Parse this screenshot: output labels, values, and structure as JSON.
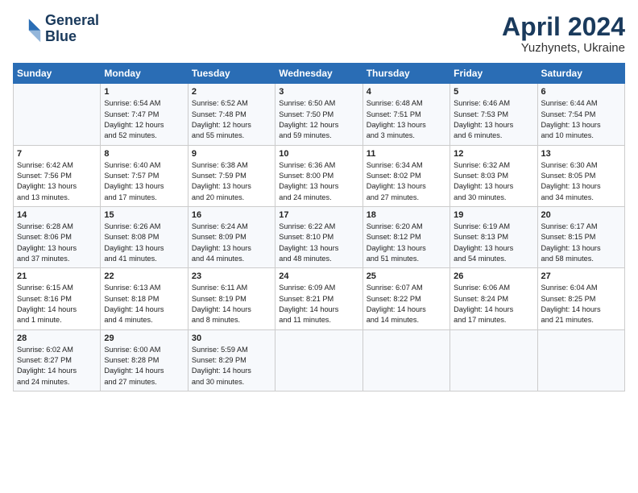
{
  "header": {
    "logo_line1": "General",
    "logo_line2": "Blue",
    "month": "April 2024",
    "location": "Yuzhynets, Ukraine"
  },
  "days_of_week": [
    "Sunday",
    "Monday",
    "Tuesday",
    "Wednesday",
    "Thursday",
    "Friday",
    "Saturday"
  ],
  "weeks": [
    [
      {
        "day": "",
        "info": ""
      },
      {
        "day": "1",
        "info": "Sunrise: 6:54 AM\nSunset: 7:47 PM\nDaylight: 12 hours\nand 52 minutes."
      },
      {
        "day": "2",
        "info": "Sunrise: 6:52 AM\nSunset: 7:48 PM\nDaylight: 12 hours\nand 55 minutes."
      },
      {
        "day": "3",
        "info": "Sunrise: 6:50 AM\nSunset: 7:50 PM\nDaylight: 12 hours\nand 59 minutes."
      },
      {
        "day": "4",
        "info": "Sunrise: 6:48 AM\nSunset: 7:51 PM\nDaylight: 13 hours\nand 3 minutes."
      },
      {
        "day": "5",
        "info": "Sunrise: 6:46 AM\nSunset: 7:53 PM\nDaylight: 13 hours\nand 6 minutes."
      },
      {
        "day": "6",
        "info": "Sunrise: 6:44 AM\nSunset: 7:54 PM\nDaylight: 13 hours\nand 10 minutes."
      }
    ],
    [
      {
        "day": "7",
        "info": "Sunrise: 6:42 AM\nSunset: 7:56 PM\nDaylight: 13 hours\nand 13 minutes."
      },
      {
        "day": "8",
        "info": "Sunrise: 6:40 AM\nSunset: 7:57 PM\nDaylight: 13 hours\nand 17 minutes."
      },
      {
        "day": "9",
        "info": "Sunrise: 6:38 AM\nSunset: 7:59 PM\nDaylight: 13 hours\nand 20 minutes."
      },
      {
        "day": "10",
        "info": "Sunrise: 6:36 AM\nSunset: 8:00 PM\nDaylight: 13 hours\nand 24 minutes."
      },
      {
        "day": "11",
        "info": "Sunrise: 6:34 AM\nSunset: 8:02 PM\nDaylight: 13 hours\nand 27 minutes."
      },
      {
        "day": "12",
        "info": "Sunrise: 6:32 AM\nSunset: 8:03 PM\nDaylight: 13 hours\nand 30 minutes."
      },
      {
        "day": "13",
        "info": "Sunrise: 6:30 AM\nSunset: 8:05 PM\nDaylight: 13 hours\nand 34 minutes."
      }
    ],
    [
      {
        "day": "14",
        "info": "Sunrise: 6:28 AM\nSunset: 8:06 PM\nDaylight: 13 hours\nand 37 minutes."
      },
      {
        "day": "15",
        "info": "Sunrise: 6:26 AM\nSunset: 8:08 PM\nDaylight: 13 hours\nand 41 minutes."
      },
      {
        "day": "16",
        "info": "Sunrise: 6:24 AM\nSunset: 8:09 PM\nDaylight: 13 hours\nand 44 minutes."
      },
      {
        "day": "17",
        "info": "Sunrise: 6:22 AM\nSunset: 8:10 PM\nDaylight: 13 hours\nand 48 minutes."
      },
      {
        "day": "18",
        "info": "Sunrise: 6:20 AM\nSunset: 8:12 PM\nDaylight: 13 hours\nand 51 minutes."
      },
      {
        "day": "19",
        "info": "Sunrise: 6:19 AM\nSunset: 8:13 PM\nDaylight: 13 hours\nand 54 minutes."
      },
      {
        "day": "20",
        "info": "Sunrise: 6:17 AM\nSunset: 8:15 PM\nDaylight: 13 hours\nand 58 minutes."
      }
    ],
    [
      {
        "day": "21",
        "info": "Sunrise: 6:15 AM\nSunset: 8:16 PM\nDaylight: 14 hours\nand 1 minute."
      },
      {
        "day": "22",
        "info": "Sunrise: 6:13 AM\nSunset: 8:18 PM\nDaylight: 14 hours\nand 4 minutes."
      },
      {
        "day": "23",
        "info": "Sunrise: 6:11 AM\nSunset: 8:19 PM\nDaylight: 14 hours\nand 8 minutes."
      },
      {
        "day": "24",
        "info": "Sunrise: 6:09 AM\nSunset: 8:21 PM\nDaylight: 14 hours\nand 11 minutes."
      },
      {
        "day": "25",
        "info": "Sunrise: 6:07 AM\nSunset: 8:22 PM\nDaylight: 14 hours\nand 14 minutes."
      },
      {
        "day": "26",
        "info": "Sunrise: 6:06 AM\nSunset: 8:24 PM\nDaylight: 14 hours\nand 17 minutes."
      },
      {
        "day": "27",
        "info": "Sunrise: 6:04 AM\nSunset: 8:25 PM\nDaylight: 14 hours\nand 21 minutes."
      }
    ],
    [
      {
        "day": "28",
        "info": "Sunrise: 6:02 AM\nSunset: 8:27 PM\nDaylight: 14 hours\nand 24 minutes."
      },
      {
        "day": "29",
        "info": "Sunrise: 6:00 AM\nSunset: 8:28 PM\nDaylight: 14 hours\nand 27 minutes."
      },
      {
        "day": "30",
        "info": "Sunrise: 5:59 AM\nSunset: 8:29 PM\nDaylight: 14 hours\nand 30 minutes."
      },
      {
        "day": "",
        "info": ""
      },
      {
        "day": "",
        "info": ""
      },
      {
        "day": "",
        "info": ""
      },
      {
        "day": "",
        "info": ""
      }
    ]
  ]
}
